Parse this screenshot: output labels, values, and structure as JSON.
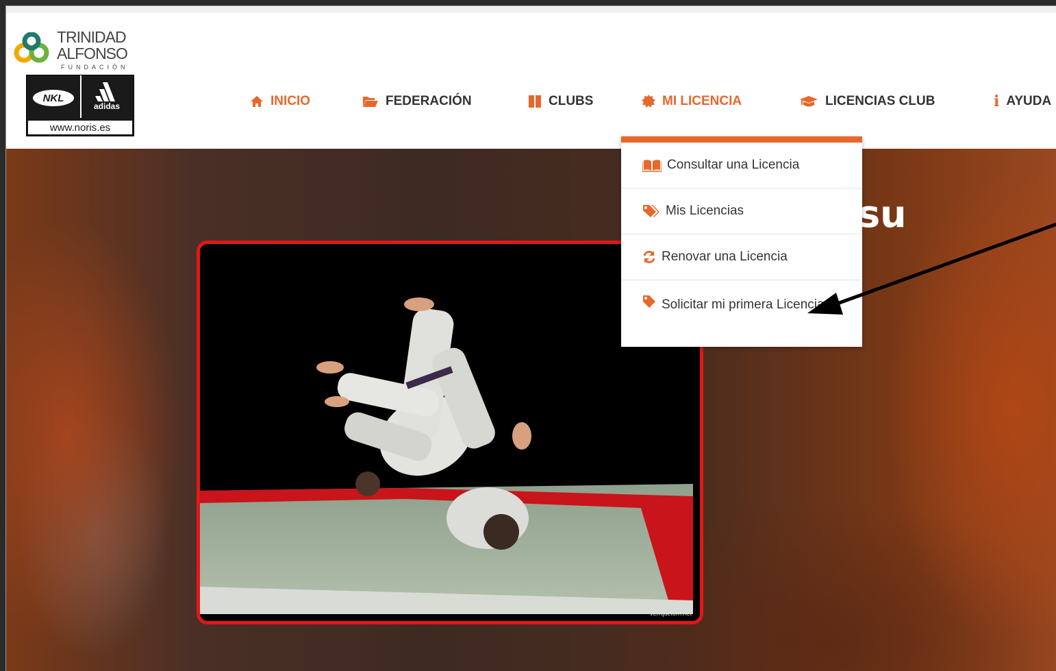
{
  "brand": {
    "fundacion_line1": "TRINIDAD",
    "fundacion_line2": "ALFONSO",
    "fundacion_sub": "FUNDACIÓN",
    "sponsor_nkl": "NKL",
    "sponsor_adidas": "adidas",
    "sponsor_url": "www.noris.es"
  },
  "nav": {
    "items": [
      {
        "label": "INICIO",
        "icon": "home-icon"
      },
      {
        "label": "FEDERACIÓN",
        "icon": "folder-open-icon"
      },
      {
        "label": "CLUBS",
        "icon": "columns-icon"
      },
      {
        "label": "MI LICENCIA",
        "icon": "certificate-icon"
      },
      {
        "label": "LICENCIAS CLUB",
        "icon": "graduation-cap-icon"
      },
      {
        "label": "AYUDA",
        "icon": "info-icon"
      }
    ],
    "active": "MI LICENCIA",
    "accent_color": "#e8672a"
  },
  "dropdown": {
    "items": [
      {
        "label": "Consultar una Licencia",
        "icon": "book-open-icon"
      },
      {
        "label": "Mis Licencias",
        "icon": "tags-icon"
      },
      {
        "label": "Renovar una Licencia",
        "icon": "refresh-icon"
      },
      {
        "label": "Solicitar mi primera Licencia",
        "icon": "tag-icon"
      }
    ]
  },
  "hero": {
    "heading_fragment": "su",
    "photo_credit": "verrquetorn.net",
    "photo_border_color": "#e01818"
  }
}
